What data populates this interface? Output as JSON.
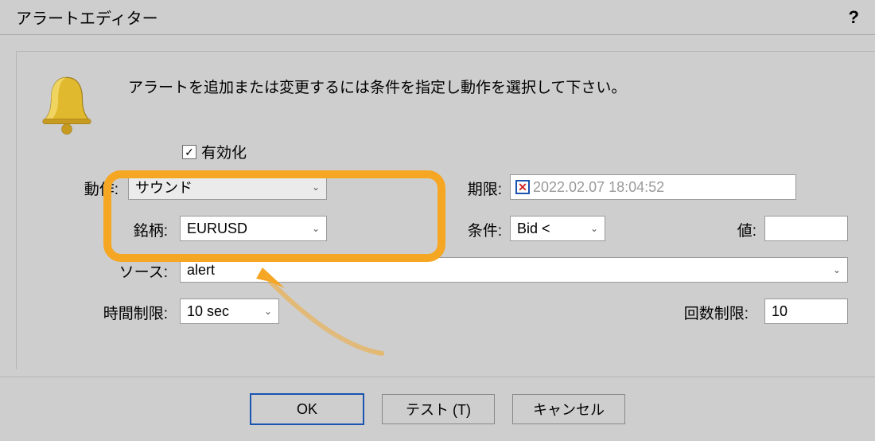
{
  "title": "アラートエディター",
  "help_symbol": "?",
  "instruction": "アラートを追加または変更するには条件を指定し動作を選択して下さい。",
  "labels": {
    "enable": "有効化",
    "action": "動作:",
    "symbol": "銘柄:",
    "source": "ソース:",
    "timeout": "時間制限:",
    "expiration": "期限:",
    "condition": "条件:",
    "value": "値:",
    "max_iter": "回数制限:"
  },
  "fields": {
    "enable_checked": "✓",
    "action": "サウンド",
    "symbol": "EURUSD",
    "source": "alert",
    "timeout": "10 sec",
    "expiration": "2022.02.07 18:04:52",
    "condition": "Bid <",
    "value": "",
    "max_iter": "10"
  },
  "buttons": {
    "ok": "OK",
    "test": "テスト (T)",
    "cancel": "キャンセル"
  }
}
